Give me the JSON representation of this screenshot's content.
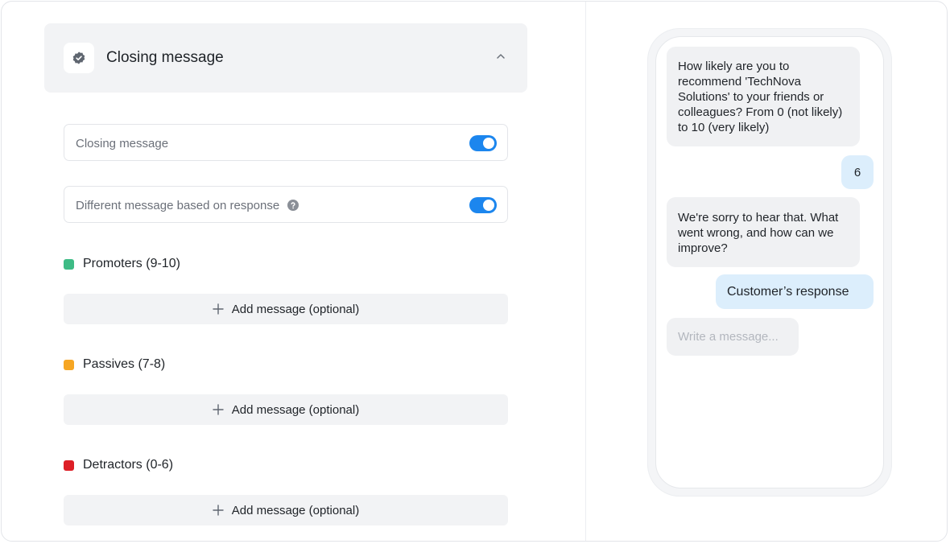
{
  "header": {
    "title": "Closing message"
  },
  "settings": {
    "closing_message": {
      "label": "Closing message",
      "enabled": true
    },
    "different_message": {
      "label": "Different message based on response",
      "enabled": true
    }
  },
  "groups": [
    {
      "label": "Promoters (9-10)",
      "color": "#3dbb85",
      "add_label": "Add message (optional)"
    },
    {
      "label": "Passives (7-8)",
      "color": "#f6a623",
      "add_label": "Add message (optional)"
    },
    {
      "label": "Detractors (0-6)",
      "color": "#dd1f26",
      "add_label": "Add message (optional)"
    }
  ],
  "preview": {
    "messages": [
      {
        "from": "bot",
        "text": "How likely are you to recommend 'TechNova Solutions' to your friends or colleagues? From 0 (not likely) to 10 (very likely)"
      },
      {
        "from": "user",
        "text": "6"
      },
      {
        "from": "bot",
        "text": "We're sorry to hear that. What went wrong, and how can we improve?"
      },
      {
        "from": "user",
        "text": "Customer’s response"
      }
    ],
    "input_placeholder": "Write a message..."
  },
  "colors": {
    "accent": "#1c86ee",
    "user_bubble": "#dceefc",
    "bot_bubble": "#f0f1f3"
  },
  "icons": {
    "header": "verified-badge-icon",
    "collapse": "chevron-up-icon",
    "help": "question-circle-icon",
    "add": "plus-icon"
  }
}
